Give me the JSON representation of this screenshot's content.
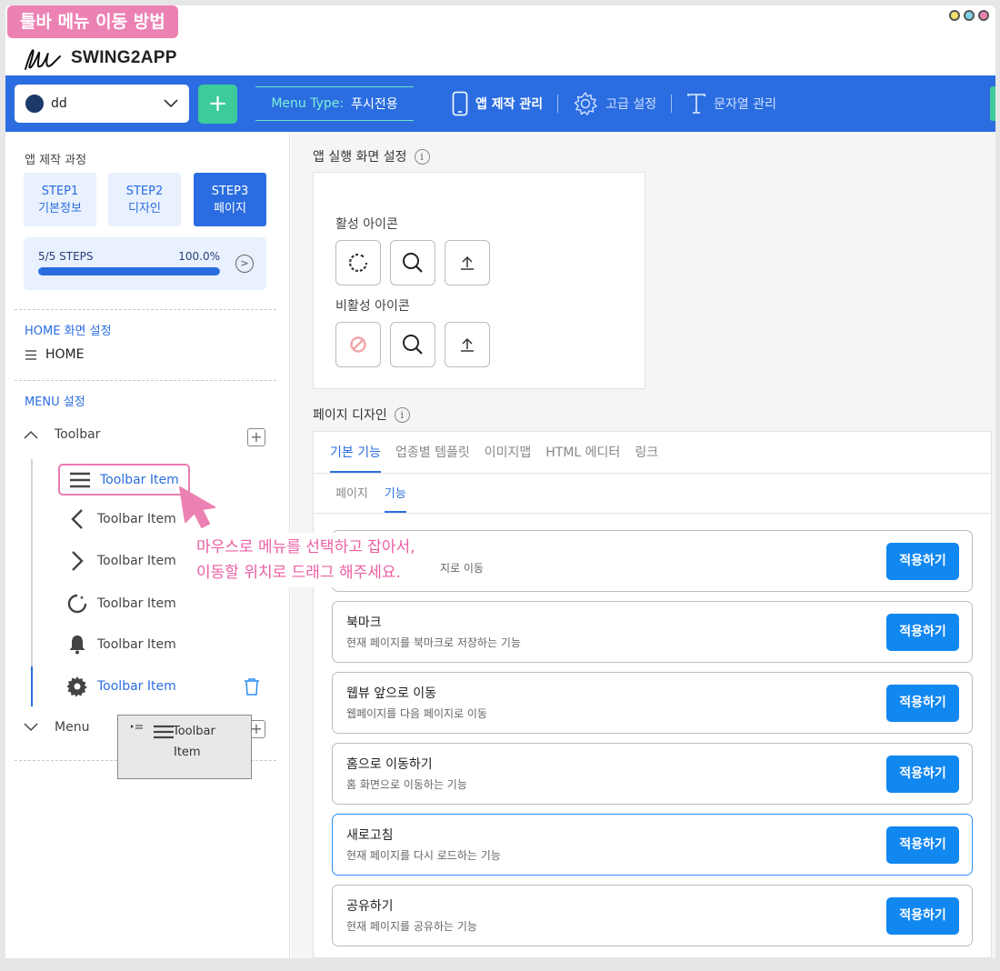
{
  "overlay": {
    "title": "툴바 메뉴 이동 방법",
    "annotation_line1": "마우스로 메뉴를 선택하고 잡아서,",
    "annotation_line2": "이동할 위치로 드래그 해주세요."
  },
  "brand": {
    "name": "SWING2APP"
  },
  "topbar": {
    "app_name": "dd",
    "add_label": "+",
    "menu_type_label": "Menu Type:",
    "menu_type_value": "푸시전용",
    "nav": [
      {
        "label": "앱 제작 관리",
        "icon": "phone-icon"
      },
      {
        "label": "고급 설정",
        "icon": "gear-icon"
      },
      {
        "label": "문자열 관리",
        "icon": "text-icon"
      }
    ]
  },
  "sidebar": {
    "process_title": "앱 제작 과정",
    "steps": [
      {
        "line1": "STEP1",
        "line2": "기본정보"
      },
      {
        "line1": "STEP2",
        "line2": "디자인"
      },
      {
        "line1": "STEP3",
        "line2": "페이지"
      }
    ],
    "progress": {
      "label": "5/5 STEPS",
      "percent_text": "100.0%",
      "value": 1.0
    },
    "home_section": "HOME 화면 설정",
    "home_item": "HOME",
    "menu_section": "MENU 설정",
    "toolbar_group": "Toolbar",
    "menu_group": "Menu",
    "toolbar_items": [
      {
        "label": "Toolbar Item",
        "icon": "hamburger-icon"
      },
      {
        "label": "Toolbar Item",
        "icon": "chevron-left-icon"
      },
      {
        "label": "Toolbar Item",
        "icon": "chevron-right-icon"
      },
      {
        "label": "Toolbar Item",
        "icon": "refresh-icon"
      },
      {
        "label": "Toolbar Item",
        "icon": "bell-icon"
      },
      {
        "label": "Toolbar Item",
        "icon": "gear-icon"
      }
    ],
    "drag_ghost": {
      "line1": "Toolbar",
      "line2": "Item"
    }
  },
  "main": {
    "launch_title": "앱 실행 화면 설정",
    "active_icons_label": "활성 아이콘",
    "inactive_icons_label": "비활성 아이콘",
    "page_design_title": "페이지 디자인",
    "tabs": [
      "기본 기능",
      "업종별 템플릿",
      "이미지맵",
      "HTML 에디터",
      "링크"
    ],
    "subtabs": [
      "페이지",
      "기능"
    ],
    "features": [
      {
        "title": "",
        "desc": "지로 이동",
        "button": "적용하기"
      },
      {
        "title": "북마크",
        "desc": "현재 페이지를 북마크로 저장하는 기능",
        "button": "적용하기"
      },
      {
        "title": "웹뷰 앞으로 이동",
        "desc": "웹페이지를 다음 페이지로 이동",
        "button": "적용하기"
      },
      {
        "title": "홈으로 이동하기",
        "desc": "홈 화면으로 이동하는 기능",
        "button": "적용하기"
      },
      {
        "title": "새로고침",
        "desc": "현재 페이지를 다시 로드하는 기능",
        "button": "적용하기"
      },
      {
        "title": "공유하기",
        "desc": "현재 페이지를 공유하는 기능",
        "button": "적용하기"
      }
    ]
  },
  "colors": {
    "primary": "#2b6de0",
    "accent_green": "#3dcb9b",
    "annotation_pink": "#ec5fa3",
    "apply_button": "#1187f0"
  }
}
